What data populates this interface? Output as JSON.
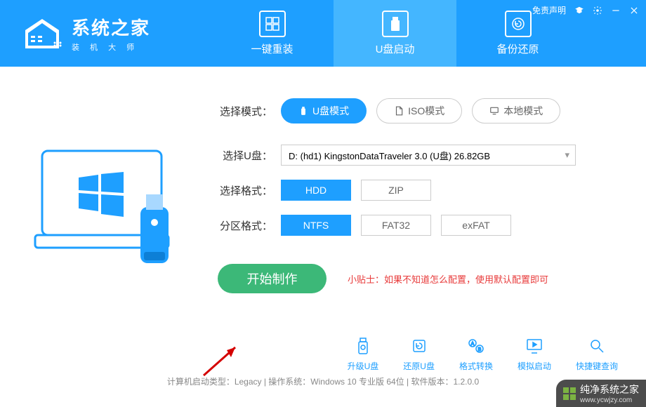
{
  "brand": {
    "title": "系统之家",
    "subtitle": "装 机 大 师"
  },
  "top_right": {
    "disclaimer": "免责声明"
  },
  "tabs": [
    {
      "label": "一键重装",
      "active": false
    },
    {
      "label": "U盘启动",
      "active": true
    },
    {
      "label": "备份还原",
      "active": false
    }
  ],
  "mode": {
    "label": "选择模式：",
    "options": [
      {
        "label": "U盘模式",
        "active": true
      },
      {
        "label": "ISO模式",
        "active": false
      },
      {
        "label": "本地模式",
        "active": false
      }
    ]
  },
  "udisk": {
    "label": "选择U盘：",
    "value": "D: (hd1) KingstonDataTraveler 3.0 (U盘) 26.82GB"
  },
  "format": {
    "label": "选择格式：",
    "options": [
      {
        "label": "HDD",
        "active": true
      },
      {
        "label": "ZIP",
        "active": false
      }
    ]
  },
  "partition": {
    "label": "分区格式：",
    "options": [
      {
        "label": "NTFS",
        "active": true
      },
      {
        "label": "FAT32",
        "active": false
      },
      {
        "label": "exFAT",
        "active": false
      }
    ]
  },
  "start": {
    "button": "开始制作",
    "tip": "小贴士：如果不知道怎么配置，使用默认配置即可"
  },
  "bottom_tools": [
    {
      "label": "升级U盘"
    },
    {
      "label": "还原U盘"
    },
    {
      "label": "格式转换"
    },
    {
      "label": "模拟启动"
    },
    {
      "label": "快捷键查询"
    }
  ],
  "statusbar": "计算机启动类型：Legacy | 操作系统：Windows 10 专业版 64位 | 软件版本：1.2.0.0",
  "watermark": {
    "title": "纯净系统之家",
    "url": "www.ycwjzy.com"
  },
  "colors": {
    "primary": "#1e9fff",
    "green": "#3cb878",
    "red": "#e83a3a"
  }
}
